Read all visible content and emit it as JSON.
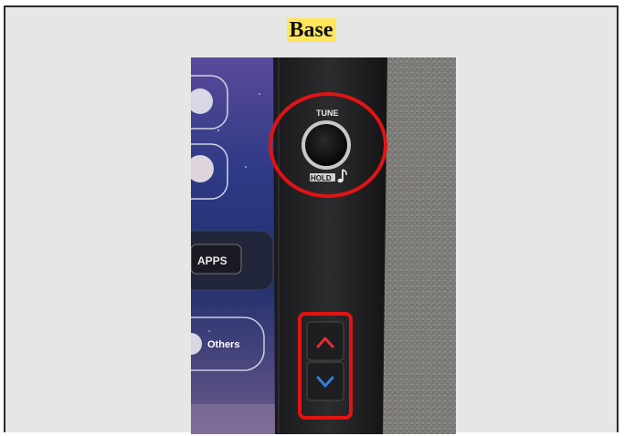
{
  "slide": {
    "title": "Base"
  },
  "photo": {
    "screen_labels": {
      "tune": "TUNE",
      "hold": "HOLD",
      "apps": "APPS",
      "others": "Others"
    },
    "highlight_color": "#e01414",
    "highlight_color_name": "red",
    "icons": [
      "music-note-icon",
      "chevron-up-icon",
      "chevron-down-icon"
    ]
  }
}
